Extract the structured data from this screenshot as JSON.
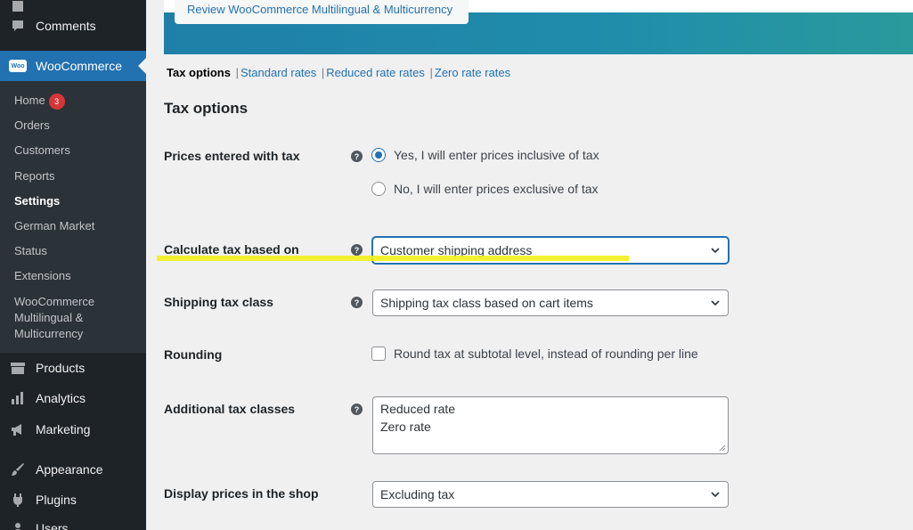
{
  "sidebar": {
    "top_items": [
      {
        "label": "Comments",
        "icon": "comment-icon"
      }
    ],
    "woocommerce": {
      "label": "WooCommerce",
      "icon": "woocommerce-logo",
      "logo_text": "Woo"
    },
    "submenu": [
      {
        "label": "Home",
        "badge": "3"
      },
      {
        "label": "Orders"
      },
      {
        "label": "Customers"
      },
      {
        "label": "Reports"
      },
      {
        "label": "Settings",
        "current": true
      },
      {
        "label": "German Market"
      },
      {
        "label": "Status"
      },
      {
        "label": "Extensions"
      },
      {
        "label": "WooCommerce Multilingual & Multicurrency"
      }
    ],
    "bottom_items": [
      {
        "label": "Products",
        "icon": "products-icon"
      },
      {
        "label": "Analytics",
        "icon": "analytics-icon"
      },
      {
        "label": "Marketing",
        "icon": "megaphone-icon"
      },
      {
        "label": "Appearance",
        "icon": "paintbrush-icon"
      },
      {
        "label": "Plugins",
        "icon": "plug-icon"
      },
      {
        "label": "Users",
        "icon": "users-icon"
      }
    ]
  },
  "banner": {
    "button_label": "Review WooCommerce Multilingual & Multicurrency"
  },
  "subnav": {
    "items": [
      "Tax options",
      "Standard rates",
      "Reduced rate rates",
      "Zero rate rates"
    ],
    "separator": "|"
  },
  "section_title": "Tax options",
  "fields": {
    "prices_entered": {
      "label": "Prices entered with tax",
      "options": [
        "Yes, I will enter prices inclusive of tax",
        "No, I will enter prices exclusive of tax"
      ],
      "selected_index": 0
    },
    "calculate_based_on": {
      "label": "Calculate tax based on",
      "value": "Customer shipping address"
    },
    "shipping_tax_class": {
      "label": "Shipping tax class",
      "value": "Shipping tax class based on cart items"
    },
    "rounding": {
      "label": "Rounding",
      "checkbox_label": "Round tax at subtotal level, instead of rounding per line",
      "checked": false
    },
    "additional_classes": {
      "label": "Additional tax classes",
      "lines": [
        "Reduced rate",
        "Zero rate"
      ]
    },
    "display_prices_shop": {
      "label": "Display prices in the shop",
      "value": "Excluding tax"
    }
  },
  "help_glyph": "?",
  "colors": {
    "accent": "#2271b1",
    "sidebar_bg": "#1d2327",
    "submenu_bg": "#2c3338",
    "badge": "#d63638",
    "highlight": "#f2ef1a"
  }
}
